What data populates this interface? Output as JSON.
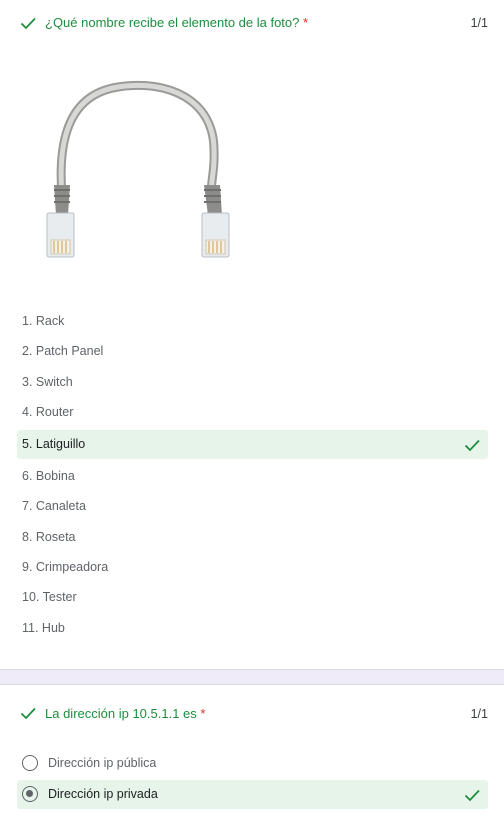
{
  "questions": [
    {
      "title": "¿Qué nombre recibe el elemento de la foto?",
      "required_mark": "*",
      "score": "1/1",
      "image_icon": "ethernet-patch-cable-photo",
      "options": [
        {
          "label": "1. Rack"
        },
        {
          "label": "2. Patch Panel"
        },
        {
          "label": "3. Switch"
        },
        {
          "label": "4. Router"
        },
        {
          "label": "5. Latiguillo",
          "correct": true
        },
        {
          "label": "6. Bobina"
        },
        {
          "label": "7. Canaleta"
        },
        {
          "label": "8. Roseta"
        },
        {
          "label": "9. Crimpeadora"
        },
        {
          "label": "10. Tester"
        },
        {
          "label": "11. Hub"
        }
      ]
    },
    {
      "title": "La dirección ip 10.5.1.1 es",
      "required_mark": "*",
      "score": "1/1",
      "options": [
        {
          "label": "Dirección ip pública",
          "selected": false
        },
        {
          "label": "Dirección ip privada",
          "selected": true,
          "correct": true
        }
      ]
    }
  ],
  "colors": {
    "correct_green": "#1e8e3e",
    "correct_bg": "#e6f4ea",
    "required_red": "#d93025",
    "page_bg": "#f0ebf8"
  }
}
